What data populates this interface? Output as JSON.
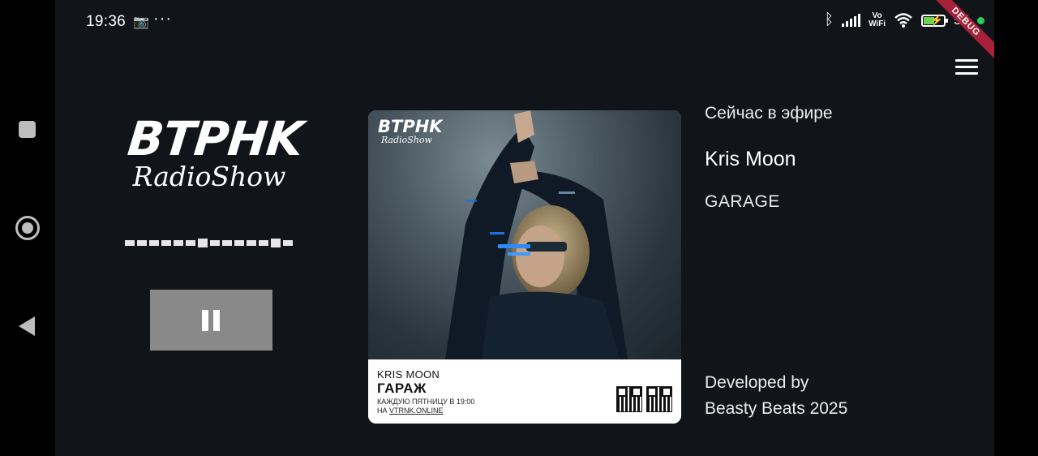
{
  "status_bar": {
    "time": "19:36",
    "battery_percent": "55",
    "battery_level": 0.55,
    "vowifi_top": "Vo",
    "vowifi_bottom": "WiFi",
    "more": "···"
  },
  "debug_banner": "DEBUG",
  "logo": {
    "main": "BTPHK",
    "sub": "RadioShow"
  },
  "now_playing": {
    "label": "Сейчас в эфире",
    "artist": "Kris Moon",
    "show": "GARAGE"
  },
  "cover": {
    "logo_main": "BTPHK",
    "logo_sub": "RadioShow",
    "artist": "KRIS MOON",
    "show": "ГАРАЖ",
    "schedule": "КАЖДУЮ ПЯТНИЦУ В 19:00",
    "site_prefix": "НА",
    "site": "VTRNK.ONLINE"
  },
  "footer": {
    "line1": "Developed by",
    "line2": "Beasty Beats 2025"
  },
  "colors": {
    "background": "#111418",
    "pause_button": "#898989",
    "debug_banner": "#a8213a",
    "battery": "#6fd14f"
  },
  "icons": {
    "menu": "hamburger-menu-icon",
    "pause": "pause-icon",
    "bluetooth": "bluetooth-icon",
    "wifi": "wifi-icon"
  }
}
